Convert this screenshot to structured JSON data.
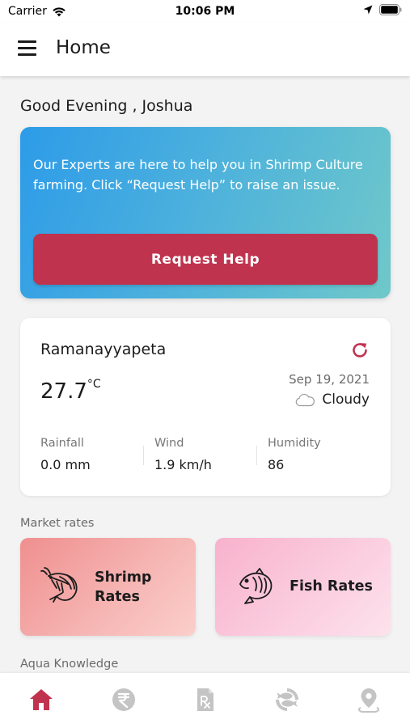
{
  "status_bar": {
    "carrier": "Carrier",
    "time": "10:06 PM",
    "wifi_icon": "wifi-icon",
    "location_icon": "location-arrow-icon",
    "battery_icon": "battery-icon"
  },
  "app_bar": {
    "title": "Home",
    "menu_icon": "hamburger-menu-icon"
  },
  "greeting": "Good Evening , Joshua",
  "help_card": {
    "text": "Our Experts are here to help you in Shrimp Culture farming. Click “Request Help” to raise an issue.",
    "button_label": "Request Help"
  },
  "weather": {
    "location": "Ramanayyapeta",
    "temperature": "27.7",
    "unit": "°C",
    "date": "Sep 19, 2021",
    "condition": "Cloudy",
    "refresh_icon": "refresh-icon",
    "condition_icon": "cloud-icon",
    "stats": [
      {
        "label": "Rainfall",
        "value": "0.0 mm"
      },
      {
        "label": "Wind",
        "value": "1.9 km/h"
      },
      {
        "label": "Humidity",
        "value": "86"
      }
    ]
  },
  "market_rates": {
    "section_title": "Market rates",
    "cards": [
      {
        "label_line1": "Shrimp",
        "label_line2": "Rates",
        "icon": "shrimp-icon"
      },
      {
        "label": "Fish Rates",
        "icon": "fish-icon"
      }
    ]
  },
  "aqua_knowledge": {
    "section_title": "Aqua Knowledge"
  },
  "bottom_nav": {
    "items": [
      {
        "icon": "home-icon",
        "active": true
      },
      {
        "icon": "rupee-icon",
        "active": false
      },
      {
        "icon": "prescription-icon",
        "active": false
      },
      {
        "icon": "fish-swap-icon",
        "active": false
      },
      {
        "icon": "location-pin-icon",
        "active": false
      }
    ]
  },
  "colors": {
    "accent": "#c0334f",
    "inactive_icon": "#c4c4c4",
    "help_gradient_start": "#2d9be8",
    "help_gradient_end": "#6fc8c9"
  }
}
